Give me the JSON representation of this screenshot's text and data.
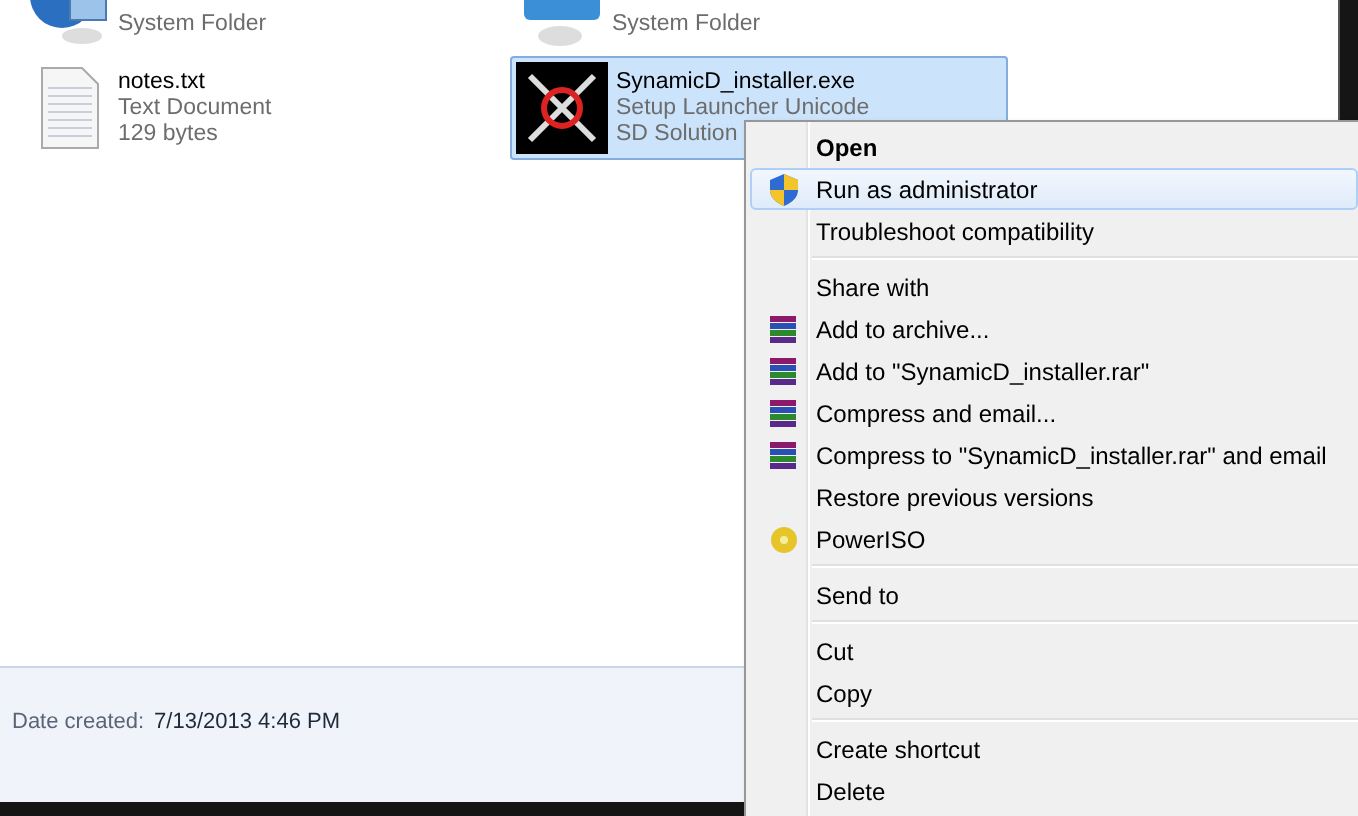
{
  "files": [
    {
      "type": "System Folder",
      "kind": "network",
      "selected": false
    },
    {
      "type": "System Folder",
      "kind": "panel",
      "selected": false
    },
    {
      "name": "notes.txt",
      "type": "Text Document",
      "size": "129 bytes",
      "kind": "text",
      "selected": false
    },
    {
      "name": "SynamicD_installer.exe",
      "type": "Setup Launcher Unicode",
      "size": "SD Solution",
      "kind": "app",
      "selected": true
    }
  ],
  "details": {
    "label": "Date created:",
    "value": "7/13/2013 4:46 PM"
  },
  "context_menu": [
    {
      "kind": "item",
      "label": "Open",
      "bold": true,
      "selected": false
    },
    {
      "kind": "shield",
      "label": "Run as administrator",
      "selected": true
    },
    {
      "kind": "item",
      "label": "Troubleshoot compatibility",
      "selected": false
    },
    {
      "kind": "separator"
    },
    {
      "kind": "item",
      "label": "Share with",
      "selected": false
    },
    {
      "kind": "archive",
      "label": "Add to archive...",
      "selected": false
    },
    {
      "kind": "archive",
      "label": "Add to \"SynamicD_installer.rar\"",
      "selected": false
    },
    {
      "kind": "archive",
      "label": "Compress and email...",
      "selected": false
    },
    {
      "kind": "archive",
      "label": "Compress to \"SynamicD_installer.rar\" and email",
      "selected": false
    },
    {
      "kind": "item",
      "label": "Restore previous versions",
      "selected": false
    },
    {
      "kind": "disc",
      "label": "PowerISO",
      "selected": false
    },
    {
      "kind": "separator"
    },
    {
      "kind": "item",
      "label": "Send to",
      "selected": false
    },
    {
      "kind": "separator"
    },
    {
      "kind": "item",
      "label": "Cut",
      "selected": false
    },
    {
      "kind": "item",
      "label": "Copy",
      "selected": false
    },
    {
      "kind": "separator"
    },
    {
      "kind": "item",
      "label": "Create shortcut",
      "selected": false
    },
    {
      "kind": "item",
      "label": "Delete",
      "selected": false
    }
  ]
}
